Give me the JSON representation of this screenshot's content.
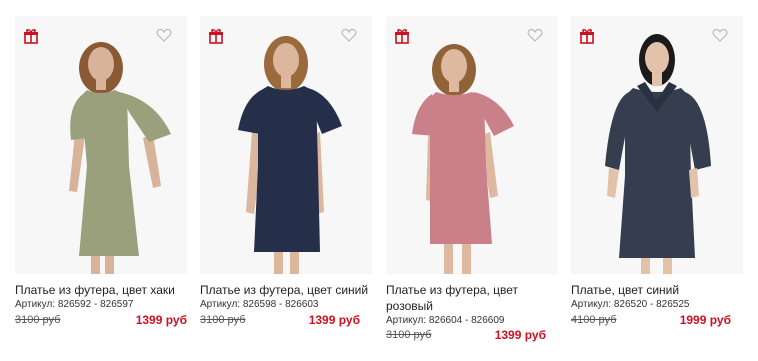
{
  "products": [
    {
      "title": "Платье из футера, цвет хаки",
      "sku": "Артикул: 826592 - 826597",
      "old_price": "3100 руб",
      "new_price": "1399 руб",
      "dress_color": "#9aa07c",
      "skin_color": "#d8b39a",
      "hair_color": "#8a5a34"
    },
    {
      "title": "Платье из футера, цвет синий",
      "sku": "Артикул: 826598 - 826603",
      "old_price": "3100 руб",
      "new_price": "1399 руб",
      "dress_color": "#262f4a",
      "skin_color": "#dcb79e",
      "hair_color": "#9a6a3c"
    },
    {
      "title": "Платье из футера, цвет розовый",
      "sku": "Артикул: 826604 - 826609",
      "old_price": "3100 руб",
      "new_price": "1399 руб",
      "dress_color": "#c98088",
      "skin_color": "#dfb8a0",
      "hair_color": "#8f6238"
    },
    {
      "title": "Платье, цвет синий",
      "sku": "Артикул: 826520 - 826525",
      "old_price": "4100 руб",
      "new_price": "1999 руб",
      "dress_color": "#343e4f",
      "skin_color": "#e3c2aa",
      "hair_color": "#1c1a1a"
    }
  ],
  "colors": {
    "sale_price": "#cc1122",
    "gift_icon": "#cc1122",
    "heart_icon": "#bbbbbb"
  }
}
